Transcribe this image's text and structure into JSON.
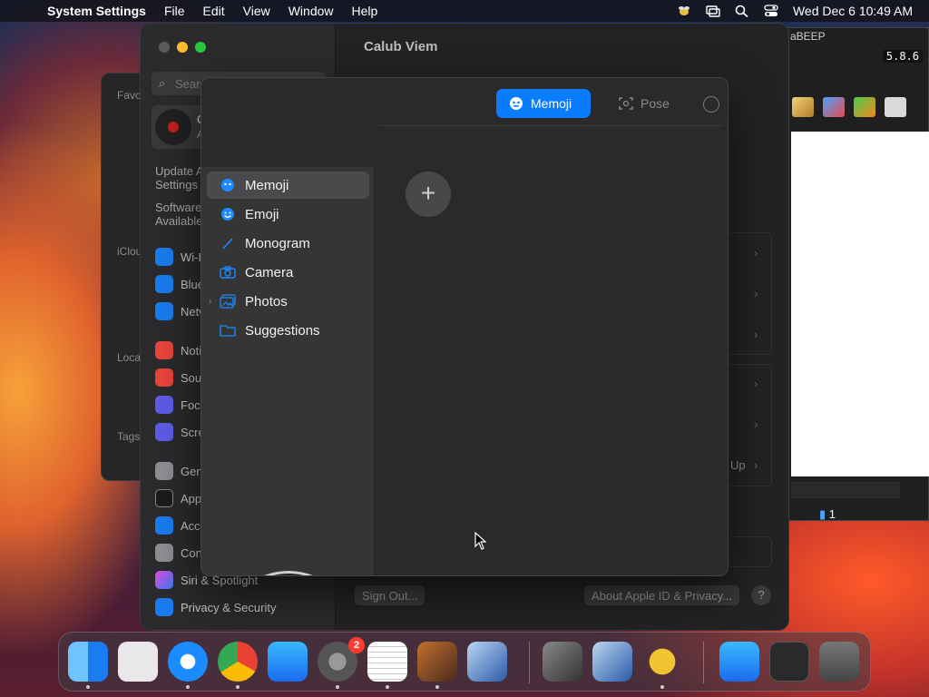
{
  "menubar": {
    "app_name": "System Settings",
    "items": [
      "File",
      "Edit",
      "View",
      "Window",
      "Help"
    ],
    "datetime": "Wed Dec 6  10:49 AM"
  },
  "behind_window": {
    "labels": [
      "Favo",
      "iClou",
      "Loca",
      "Tags"
    ]
  },
  "beep_window": {
    "title": "aBEEP",
    "version": "5.8.6",
    "status": "1"
  },
  "settings": {
    "title": "Calub Viem",
    "search_placeholder": "Search",
    "profile_initial": "C",
    "profile_sub": "A",
    "update_text": "Update A Settings",
    "software_text": "Software Available",
    "sidebar": [
      "Wi-Fi",
      "Blue",
      "Netw",
      "Noti",
      "Sou",
      "Focu",
      "Scre",
      "Gen",
      "App",
      "Acc",
      "Con",
      "Siri & Spotlight",
      "Privacy & Security"
    ],
    "up_label": "Up",
    "sign_out": "Sign Out...",
    "about": "About Apple ID & Privacy...",
    "help": "?"
  },
  "picker": {
    "tab_memoji": "Memoji",
    "tab_pose": "Pose",
    "categories": [
      "Memoji",
      "Emoji",
      "Monogram",
      "Camera",
      "Photos",
      "Suggestions"
    ],
    "add": "+"
  },
  "dock": {
    "settings_badge": "2"
  },
  "colors": {
    "accent": "#0a7cff",
    "badge": "#ff3b30"
  }
}
